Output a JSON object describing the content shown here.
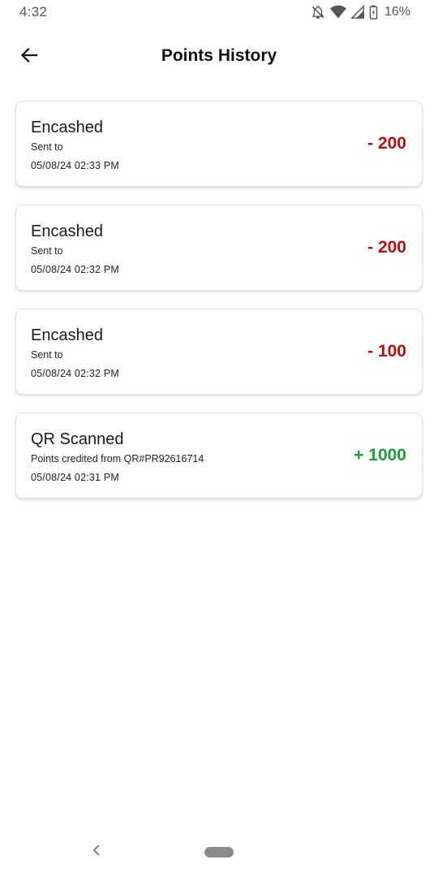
{
  "status_bar": {
    "time": "4:32",
    "battery_percent": "16%",
    "icons": [
      "notifications-off-icon",
      "wifi-icon",
      "cellular-signal-icon",
      "battery-icon"
    ]
  },
  "app_bar": {
    "title": "Points History",
    "back_icon": "arrow-left-icon"
  },
  "history": [
    {
      "title": "Encashed",
      "subtitle": "Sent to",
      "date": "05/08/24 02:33 PM",
      "points": "- 200",
      "type": "debit"
    },
    {
      "title": "Encashed",
      "subtitle": "Sent to",
      "date": "05/08/24 02:32 PM",
      "points": "- 200",
      "type": "debit"
    },
    {
      "title": "Encashed",
      "subtitle": "Sent to",
      "date": "05/08/24 02:32 PM",
      "points": "- 100",
      "type": "debit"
    },
    {
      "title": "QR Scanned",
      "subtitle": "Points credited from QR#PR92616714",
      "date": "05/08/24 02:31 PM",
      "points": "+ 1000",
      "type": "credit"
    }
  ],
  "colors": {
    "debit": "#b80f0f",
    "credit": "#1e9e3a"
  },
  "nav_bar": {
    "back_icon": "chevron-left-icon",
    "home_icon": "home-pill-icon"
  }
}
